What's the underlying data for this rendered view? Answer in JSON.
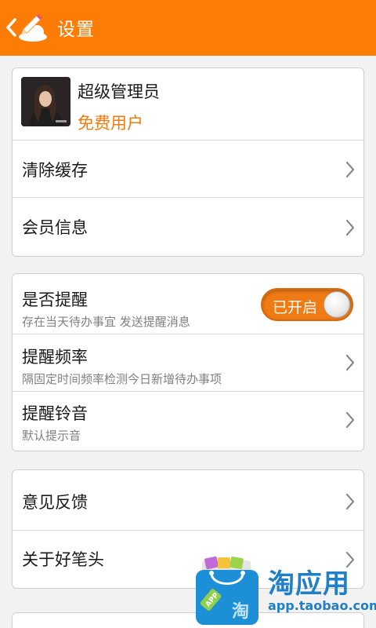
{
  "header": {
    "title": "设置",
    "back_icon": "chevron-left-icon",
    "logo_icon": "pencil-cloud-icon",
    "background_color": "#fd7c06"
  },
  "profile": {
    "name": "超级管理员",
    "tier": "免费用户",
    "tier_color": "#f57a0d"
  },
  "account_items": [
    {
      "label": "清除缓存"
    },
    {
      "label": "会员信息"
    }
  ],
  "reminder": {
    "label": "是否提醒",
    "description": "存在当天待办事宜 发送提醒消息",
    "toggle_label": "已开启",
    "toggle_on": true
  },
  "reminder_items": [
    {
      "label": "提醒频率",
      "description": "隔固定时间频率检测今日新增待办事项"
    },
    {
      "label": "提醒铃音",
      "description": "默认提示音"
    }
  ],
  "misc_items": [
    {
      "label": "意见反馈"
    },
    {
      "label": "关于好笔头"
    }
  ],
  "watermark": {
    "name": "淘应用",
    "url": "app.taobao.com",
    "badge_text": "APP",
    "icon": "shopping-bag-icon",
    "color": "#1f7fc8"
  }
}
